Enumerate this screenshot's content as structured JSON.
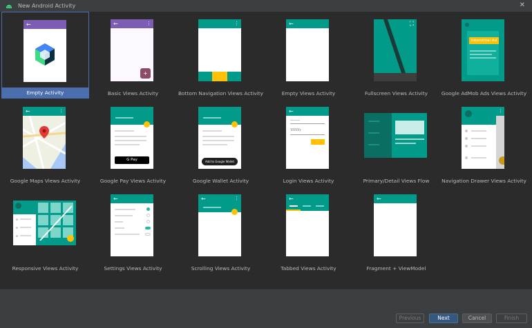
{
  "window": {
    "title": "New Android Activity",
    "icon": "android-icon",
    "close_glyph": "✕"
  },
  "templates": [
    {
      "label": "Empty Activity",
      "selected": true
    },
    {
      "label": "Basic Views Activity",
      "fab_glyph": "+"
    },
    {
      "label": "Bottom Navigation Views Activity"
    },
    {
      "label": "Empty Views Activity"
    },
    {
      "label": "Fullscreen Views Activity"
    },
    {
      "label": "Google AdMob Ads Views Activity",
      "ad_badge": "Interstitial Ad"
    },
    {
      "label": "Google Maps Views Activity"
    },
    {
      "label": "Google Pay Views Activity",
      "pay_button": "G Pay"
    },
    {
      "label": "Google Wallet Activity",
      "wallet_button": "Add to Google Wallet"
    },
    {
      "label": "Login Views Activity",
      "password_mask": "••••••"
    },
    {
      "label": "Primary/Detail Views Flow"
    },
    {
      "label": "Navigation Drawer Views Activity"
    },
    {
      "label": "Responsive Views Activity"
    },
    {
      "label": "Settings Views Activity"
    },
    {
      "label": "Scrolling Views Activity"
    },
    {
      "label": "Tabbed Views Activity"
    },
    {
      "label": "Fragment + ViewModel"
    }
  ],
  "icons": {
    "back": "←",
    "overflow": "⋮",
    "fullscreen": "⛶"
  },
  "colors": {
    "teal": "#029a89",
    "purple": "#7d5db4",
    "amber": "#ffc107",
    "selection": "#4b6eaf"
  },
  "buttons": {
    "previous": "Previous",
    "next": "Next",
    "cancel": "Cancel",
    "finish": "Finish"
  }
}
